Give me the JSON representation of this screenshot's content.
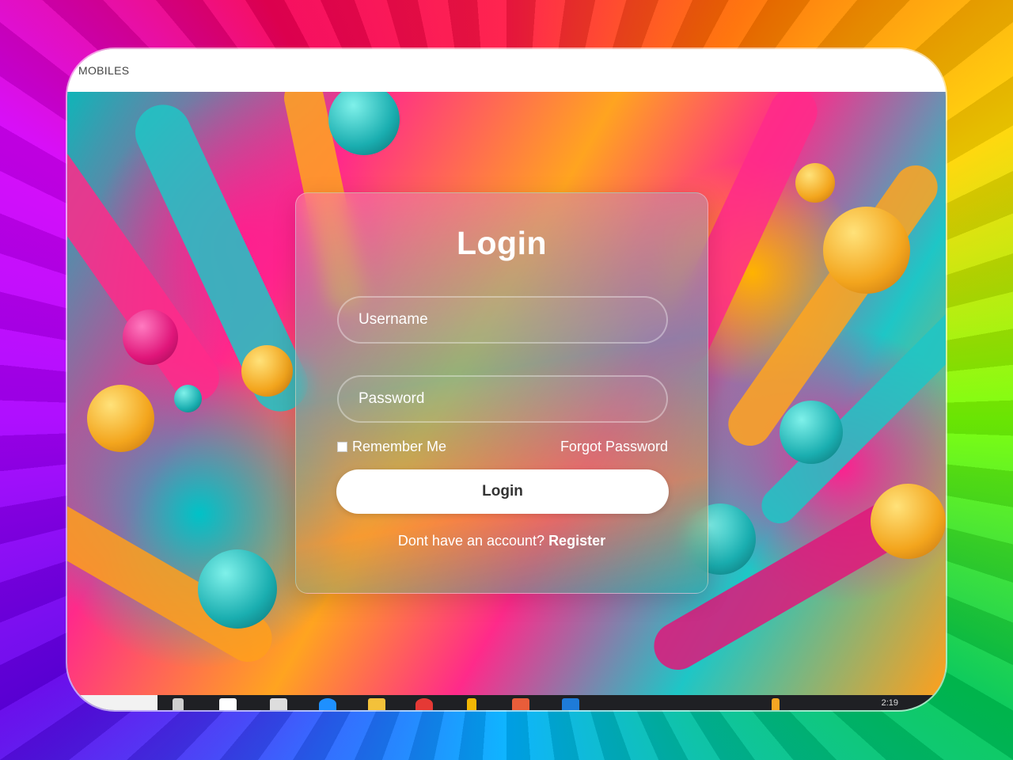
{
  "window": {
    "title": "MOBILES"
  },
  "login_form": {
    "heading": "Login",
    "username_placeholder": "Username",
    "password_placeholder": "Password",
    "remember_label": "Remember Me",
    "forgot_label": "Forgot Password",
    "submit_label": "Login",
    "register_prompt": "Dont have an account?",
    "register_link": "Register"
  },
  "taskbar": {
    "clock_text": "2:19"
  },
  "colors": {
    "card_text": "#ffffff",
    "button_bg": "#ffffff",
    "button_text": "#333333"
  }
}
